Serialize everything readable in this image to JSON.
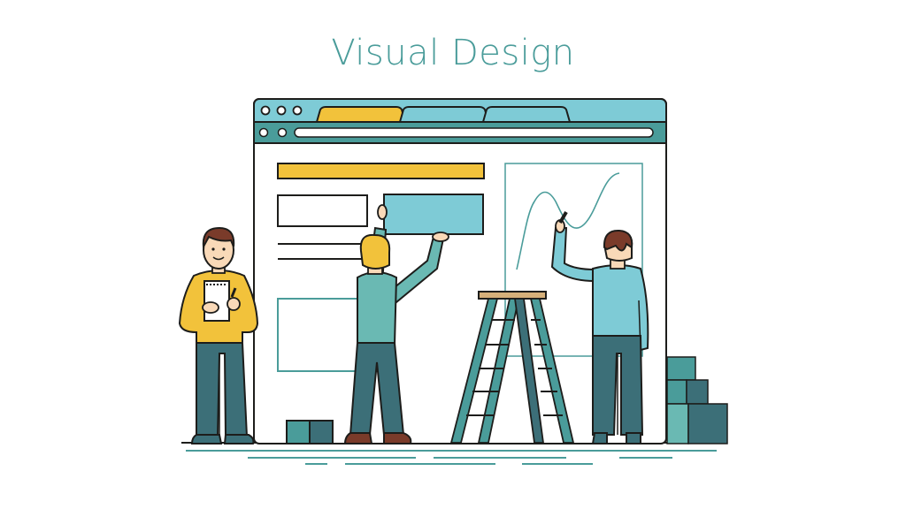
{
  "header": {
    "title": "Visual Design"
  },
  "palette": {
    "ink": "#1d1d1b",
    "teal": "#4a9c9a",
    "teal_dark": "#3c6f78",
    "light_blue": "#7ecbd6",
    "mint": "#6ab9b3",
    "yellow": "#f2c23b",
    "wood": "#d6b07a",
    "hair_brown": "#7a3b2a",
    "skin": "#f9d9b8",
    "title_color": "#4a9c9a"
  },
  "illustration": {
    "icons": [
      "browser-window-icon",
      "ladder-icon",
      "stacked-boxes-icon",
      "notepad-icon",
      "marker-icon"
    ]
  }
}
